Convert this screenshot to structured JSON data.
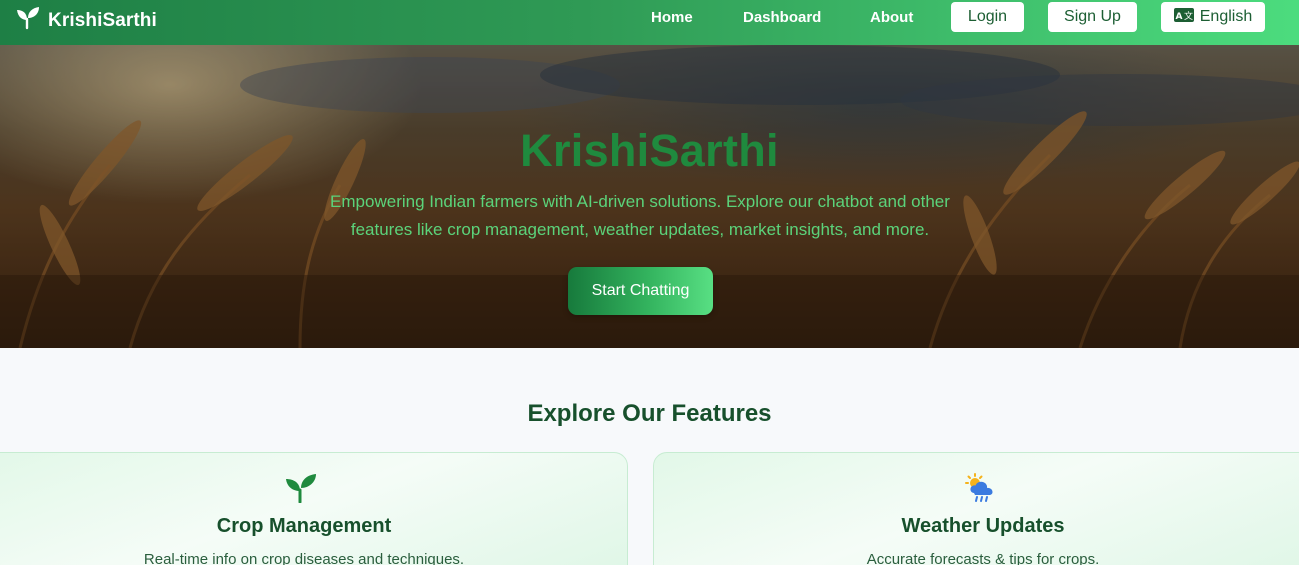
{
  "navbar": {
    "brand": "KrishiSarthi",
    "links": {
      "home": "Home",
      "dashboard": "Dashboard",
      "about": "About"
    },
    "login": "Login",
    "signup": "Sign Up",
    "language": "English",
    "language_icon_glyph": "A文",
    "icons": {
      "brand": "sprout-icon",
      "language": "translate-icon"
    }
  },
  "hero": {
    "title": "KrishiSarthi",
    "subtitle": "Empowering Indian farmers with AI-driven solutions. Explore our chatbot and other features like crop management, weather updates, market insights, and more.",
    "cta": "Start Chatting"
  },
  "features": {
    "title": "Explore Our Features",
    "cards": [
      {
        "title": "Crop Management",
        "desc": "Real-time info on crop diseases and techniques.",
        "icon": "sprout-icon"
      },
      {
        "title": "Weather Updates",
        "desc": "Accurate forecasts & tips for crops.",
        "icon": "weather-icon"
      }
    ]
  },
  "colors": {
    "brand_green": "#1f8a3e",
    "nav_gradient_start": "#1e7f45",
    "nav_gradient_end": "#4cdc7e",
    "heading_dark_green": "#17502c"
  }
}
